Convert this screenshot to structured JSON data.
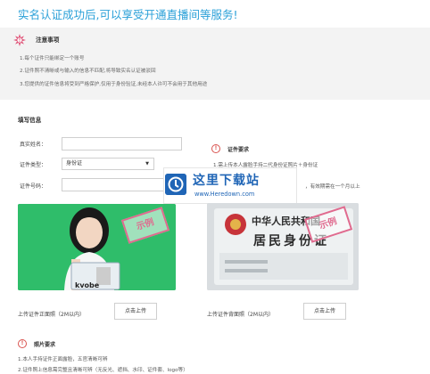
{
  "header": {
    "title": "实名认证成功后,可以享受开通直播间等服务!"
  },
  "notice": {
    "title": "注意事项",
    "lines": [
      "1.每个证件只能绑定一个账号",
      "2.证件照不清晰或与输入的信息不匹配,将导致实名认证被驳回",
      "3.您提供的证件信息将受到严格保护,仅用于身份验证,未经本人许可不会用于其他用途"
    ]
  },
  "form": {
    "section_title": "填写信息",
    "name_label": "真实姓名：",
    "name_value": "",
    "type_label": "证件类型：",
    "type_selected": "身份证",
    "number_label": "证件号码：",
    "number_value": ""
  },
  "requirements": {
    "title": "证件要求",
    "lines": [
      "1.需上传本人露脸手持二代身份证照片＋身份证",
      "...",
      "，有效期需在一个月以上"
    ]
  },
  "watermark": {
    "title": "这里下载站",
    "url": "www.Heredown.com"
  },
  "samples": {
    "stamp_text": "示例",
    "card_header": "中华人民共和国",
    "card_title": "居民身份证"
  },
  "uploads": {
    "front_label": "上传证件正面照（2M以内）",
    "back_label": "上传证件背面照（2M以内）",
    "button_label": "点击上传"
  },
  "photo_requirements": {
    "title": "照片要求",
    "lines": [
      "1.本人手持证件正面露脸，五官清晰可辨",
      "2.证件照上信息需完整且清晰可辨（无反光、遮挡、水印、证件套、logo等）"
    ]
  },
  "colors": {
    "accent": "#2aa0d8",
    "notice_bg": "#f3f3f3",
    "stamp": "#e06b8f",
    "warn": "#d9534f",
    "watermark": "#1f65b6",
    "photo_green": "#2fbd6a"
  }
}
